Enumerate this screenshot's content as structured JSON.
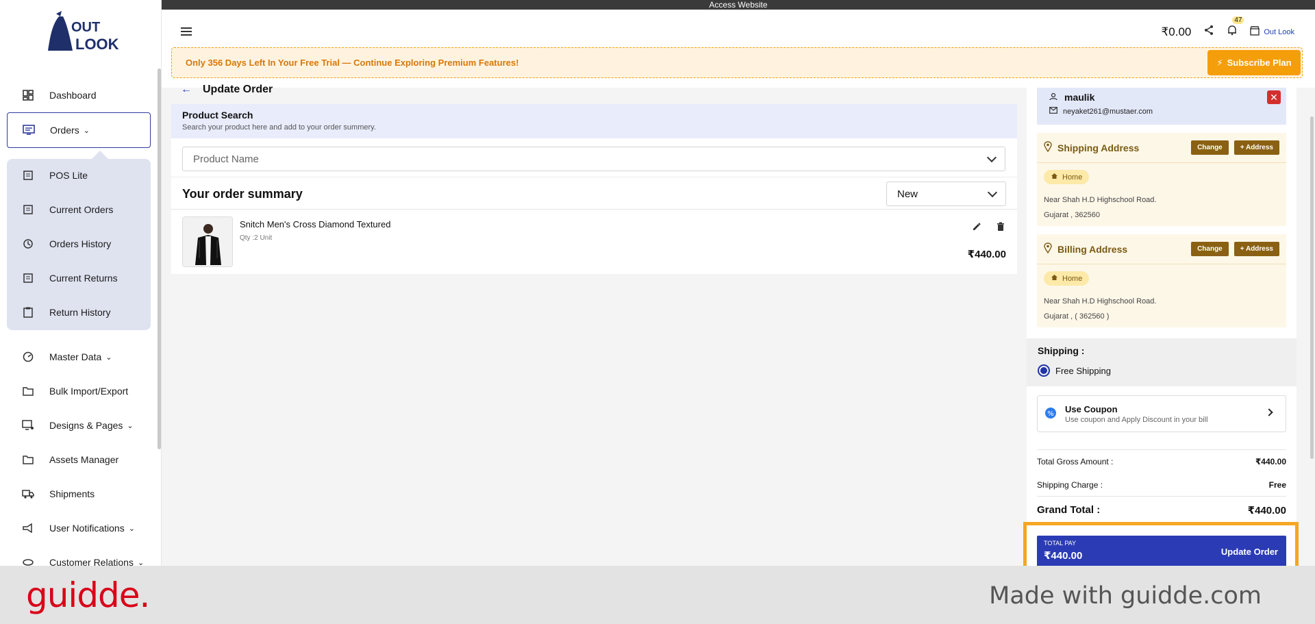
{
  "topbar": {
    "label": "Access Website"
  },
  "header": {
    "balance": "₹0.00",
    "notification_count": "47",
    "store_name": "Out Look",
    "trial_text": "Only 356 Days Left In Your Free Trial — Continue Exploring Premium Features!",
    "subscribe_label": "Subscribe Plan"
  },
  "sidebar": {
    "logo_text_top": "OUT",
    "logo_text_bottom": "LOOK",
    "items": [
      {
        "label": "Dashboard"
      },
      {
        "label": "Orders"
      },
      {
        "label": "POS Lite"
      },
      {
        "label": "Current Orders"
      },
      {
        "label": "Orders History"
      },
      {
        "label": "Current Returns"
      },
      {
        "label": "Return History"
      },
      {
        "label": "Master Data"
      },
      {
        "label": "Bulk Import/Export"
      },
      {
        "label": "Designs & Pages"
      },
      {
        "label": "Assets Manager"
      },
      {
        "label": "Shipments"
      },
      {
        "label": "User Notifications"
      },
      {
        "label": "Customer Relations"
      }
    ]
  },
  "main": {
    "title": "Update Order",
    "search": {
      "title": "Product Search",
      "subtitle": "Search your product here and add to your order summery.",
      "placeholder": "Product Name"
    },
    "summary": {
      "title": "Your order summary",
      "status": "New"
    },
    "items": [
      {
        "name": "Snitch Men's Cross Diamond Textured",
        "qty": "Qty :2 Unit",
        "price": "₹440.00"
      }
    ]
  },
  "customer": {
    "name": "maulik",
    "email": "neyaket261@mustaer.com"
  },
  "shipping_address": {
    "title": "Shipping Address",
    "change_label": "Change",
    "add_label": "+ Address",
    "tag": "Home",
    "line1": "Near Shah H.D Highschool Road.",
    "line2": "Gujarat , 362560"
  },
  "billing_address": {
    "title": "Billing Address",
    "change_label": "Change",
    "add_label": "+ Address",
    "tag": "Home",
    "line1": "Near Shah H.D Highschool Road.",
    "line2": "Gujarat , ( 362560 )"
  },
  "shipping": {
    "title": "Shipping :",
    "option": "Free Shipping"
  },
  "coupon": {
    "title": "Use Coupon",
    "subtitle": "Use coupon and Apply Discount in your bill"
  },
  "totals": {
    "gross_label": "Total Gross Amount :",
    "gross_value": "₹440.00",
    "shipping_label": "Shipping Charge :",
    "shipping_value": "Free",
    "grand_label": "Grand Total :",
    "grand_value": "₹440.00"
  },
  "paybar": {
    "label": "TOTAL PAY",
    "value": "₹440.00",
    "action": "Update Order"
  },
  "footer": {
    "brand": "guidde.",
    "tagline": "Made with guidde.com"
  },
  "colors": {
    "accent": "#2b3bb5",
    "warning": "#f59e0b",
    "brand_brown": "#8a6012",
    "danger": "#d32f2f",
    "guidde_red": "#d90018"
  }
}
